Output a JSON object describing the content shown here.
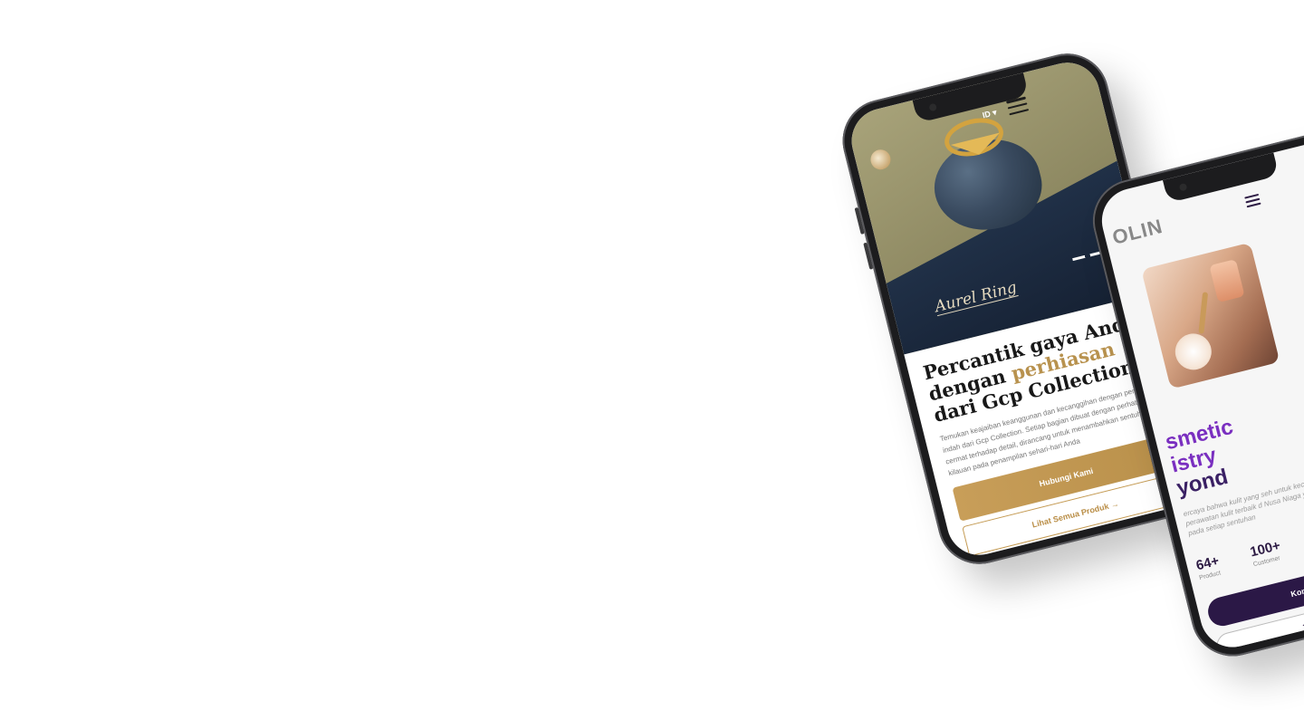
{
  "phone_jewelry": {
    "lang": "ID",
    "hero_caption": "Aurel Ring",
    "headline_part1": "Percantik gaya Anda dengan ",
    "headline_highlight": "perhiasan",
    "headline_part2": " dari Gcp Collection",
    "description": "Temukan keajaiban keanggunan dan kecanggihan dengan perhiasan indah dari Gcp Collection. Setiap bagian dibuat dengan perhatian cermat terhadap detail, dirancang untuk menambahkan sentuhan kilauan pada penampilan sehari-hari Anda",
    "primary_button": "Hubungi Kami",
    "secondary_button": "Lihat Semua Produk →",
    "accent_color": "#c49a52"
  },
  "phone_cosmetics": {
    "brand": "OLIN",
    "title_line1": "smetic",
    "title_line2": "istry",
    "title_line3": "yond",
    "description": "ercaya bahwa kulit yang seh untuk kecantikan sejati. Ten awa perawatan kulit terbaik d Nusa Niaga yang akan memba istimewa pada setiap sentuhan",
    "stats": [
      {
        "value": "64+",
        "label": "Product"
      },
      {
        "value": "100+",
        "label": "Customer"
      }
    ],
    "primary_button": "Kontak Kam",
    "secondary_button": "Tentang K",
    "accent_color": "#2b1846"
  }
}
